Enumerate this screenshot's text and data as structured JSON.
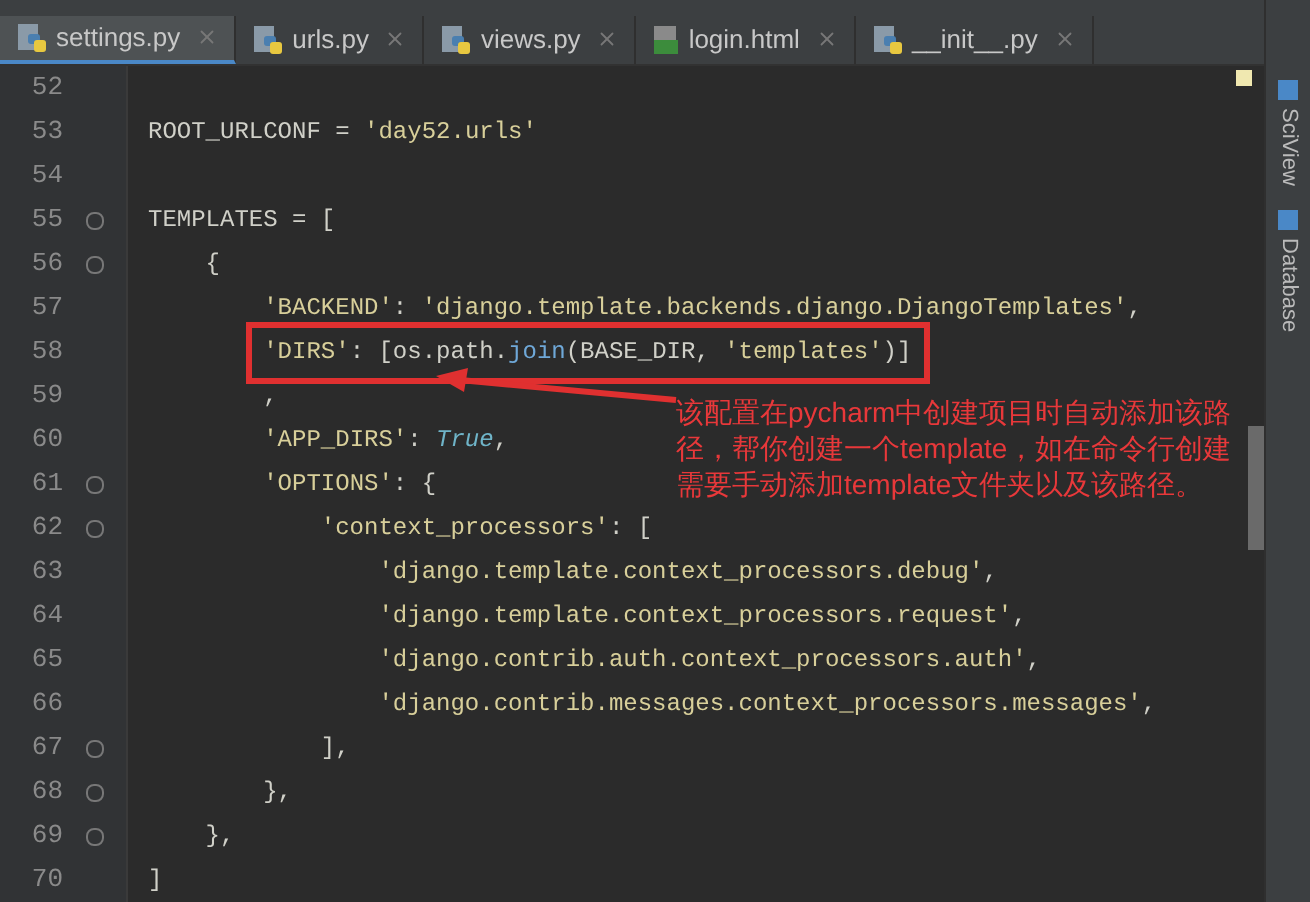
{
  "tabs": [
    {
      "label": "settings.py",
      "kind": "python",
      "selected": true
    },
    {
      "label": "urls.py",
      "kind": "python",
      "selected": false
    },
    {
      "label": "views.py",
      "kind": "python",
      "selected": false
    },
    {
      "label": "login.html",
      "kind": "html",
      "selected": false
    },
    {
      "label": "__init__.py",
      "kind": "python",
      "selected": false
    }
  ],
  "lines": [
    {
      "number": "52",
      "fold": false
    },
    {
      "number": "53",
      "fold": false,
      "highlighted": false,
      "segments": [
        {
          "text": "ROOT_URLCONF = ",
          "kind": "plain"
        },
        {
          "text": "'day52.urls'",
          "kind": "string"
        }
      ]
    },
    {
      "number": "54",
      "fold": false
    },
    {
      "number": "55",
      "fold": true,
      "highlighted": false,
      "segments": [
        {
          "text": "TEMPLATES = [",
          "kind": "plain"
        }
      ]
    },
    {
      "number": "56",
      "fold": true,
      "highlighted": false,
      "segments": [
        {
          "text": "    {",
          "kind": "plain"
        }
      ]
    },
    {
      "number": "57",
      "fold": false,
      "highlighted": false,
      "segments": [
        {
          "text": "        'BACKEND'",
          "kind": "string"
        },
        {
          "text": ": ",
          "kind": "plain"
        },
        {
          "text": "'django.template.backends.django.DjangoTemplates'",
          "kind": "string"
        },
        {
          "text": ",",
          "kind": "plain"
        }
      ]
    },
    {
      "number": "58",
      "fold": false,
      "highlighted": true,
      "segments": [
        {
          "text": "        'DIRS'",
          "kind": "string"
        },
        {
          "text": ": [os.path.",
          "kind": "plain"
        },
        {
          "text": "join",
          "kind": "builtin"
        },
        {
          "text": "(BASE_DIR, ",
          "kind": "plain"
        },
        {
          "text": "'templates'",
          "kind": "string"
        },
        {
          "text": ")]",
          "kind": "plain"
        }
      ]
    },
    {
      "number": "59",
      "fold": false,
      "highlighted": false,
      "segments": [
        {
          "text": "        ,",
          "kind": "plain"
        }
      ]
    },
    {
      "number": "60",
      "fold": false,
      "highlighted": false,
      "segments": [
        {
          "text": "        'APP_DIRS'",
          "kind": "string"
        },
        {
          "text": ": ",
          "kind": "plain"
        },
        {
          "text": "True",
          "kind": "keyword"
        },
        {
          "text": ",",
          "kind": "plain"
        }
      ]
    },
    {
      "number": "61",
      "fold": true,
      "highlighted": false,
      "segments": [
        {
          "text": "        'OPTIONS'",
          "kind": "string"
        },
        {
          "text": ": {",
          "kind": "plain"
        }
      ]
    },
    {
      "number": "62",
      "fold": true,
      "highlighted": false,
      "segments": [
        {
          "text": "            'context_processors'",
          "kind": "string"
        },
        {
          "text": ": [",
          "kind": "plain"
        }
      ]
    },
    {
      "number": "63",
      "fold": false,
      "highlighted": false,
      "segments": [
        {
          "text": "                'django.template.context_processors.debug'",
          "kind": "string"
        },
        {
          "text": ",",
          "kind": "plain"
        }
      ]
    },
    {
      "number": "64",
      "fold": false,
      "highlighted": false,
      "segments": [
        {
          "text": "                'django.template.context_processors.request'",
          "kind": "string"
        },
        {
          "text": ",",
          "kind": "plain"
        }
      ]
    },
    {
      "number": "65",
      "fold": false,
      "highlighted": false,
      "segments": [
        {
          "text": "                'django.contrib.auth.context_processors.auth'",
          "kind": "string"
        },
        {
          "text": ",",
          "kind": "plain"
        }
      ]
    },
    {
      "number": "66",
      "fold": false,
      "highlighted": false,
      "segments": [
        {
          "text": "                'django.contrib.messages.context_processors.messages'",
          "kind": "string"
        },
        {
          "text": ",",
          "kind": "plain"
        }
      ]
    },
    {
      "number": "67",
      "fold": true,
      "highlighted": false,
      "segments": [
        {
          "text": "            ],",
          "kind": "plain"
        }
      ]
    },
    {
      "number": "68",
      "fold": true,
      "highlighted": false,
      "segments": [
        {
          "text": "        },",
          "kind": "plain"
        }
      ]
    },
    {
      "number": "69",
      "fold": true,
      "highlighted": false,
      "segments": [
        {
          "text": "    },",
          "kind": "plain"
        }
      ]
    },
    {
      "number": "70",
      "fold": false,
      "highlighted": false,
      "segments": [
        {
          "text": "]",
          "kind": "plain"
        }
      ]
    }
  ],
  "annotation": {
    "text": "该配置在pycharm中创建项目时自动添加该路径，帮你创建一个template，如在命令行创建需要手动添加template文件夹以及该路径。"
  },
  "tool_strip": [
    "SciView",
    "Database"
  ]
}
